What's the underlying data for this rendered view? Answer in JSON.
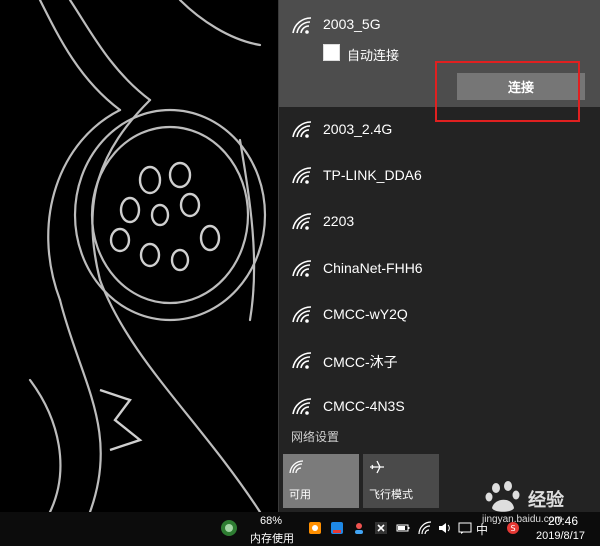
{
  "wifi": {
    "expanded_network": {
      "name": "2003_5G",
      "auto_connect_label": "自动连接",
      "auto_connect_checked": false,
      "connect_label": "连接"
    },
    "networks": [
      {
        "name": "2003_2.4G"
      },
      {
        "name": "TP-LINK_DDA6"
      },
      {
        "name": "2203"
      },
      {
        "name": "ChinaNet-FHH6"
      },
      {
        "name": "CMCC-wY2Q"
      },
      {
        "name": "CMCC-沐子"
      },
      {
        "name": "CMCC-4N3S"
      }
    ],
    "network_settings_label": "网络设置",
    "tiles": [
      {
        "label": "可用",
        "icon": "wifi-icon",
        "active": true
      },
      {
        "label": "飞行模式",
        "icon": "airplane-icon",
        "active": false
      }
    ],
    "highlight_color": "#e02020"
  },
  "taskbar": {
    "memory_percent": "68%",
    "memory_label": "内存使用",
    "ime_label": "中",
    "clock_time": "20:46",
    "clock_date": "2019/8/17",
    "tray_icons": [
      "browser-icon",
      "ie-icon",
      "user-icon",
      "people-icon",
      "close-icon",
      "battery-icon",
      "wifi-icon",
      "volume-icon",
      "notification-icon",
      "sogou-icon"
    ]
  },
  "watermark": {
    "text": "经验",
    "url": "jingyan.baidu.com"
  }
}
